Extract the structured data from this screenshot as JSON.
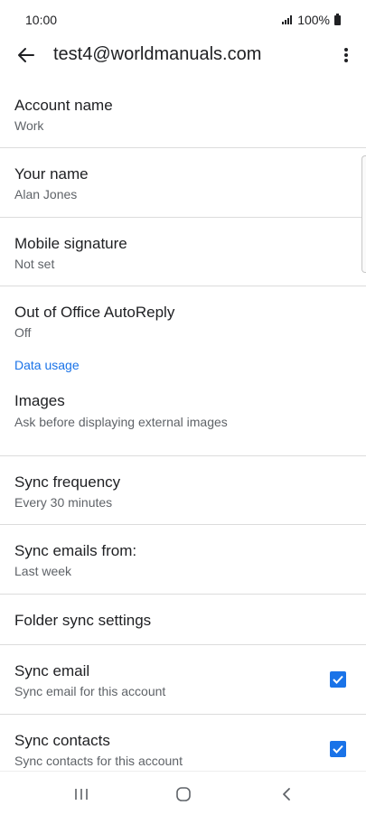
{
  "status": {
    "time": "10:00",
    "battery": "100%"
  },
  "header": {
    "title": "test4@worldmanuals.com"
  },
  "items": [
    {
      "label": "Account name",
      "sub": "Work"
    },
    {
      "label": "Your name",
      "sub": "Alan Jones"
    },
    {
      "label": "Mobile signature",
      "sub": "Not set"
    },
    {
      "label": "Out of Office AutoReply",
      "sub": "Off"
    }
  ],
  "data_usage": {
    "header": "Data usage",
    "items": [
      {
        "label": "Images",
        "sub": "Ask before displaying external images"
      },
      {
        "label": "Sync frequency",
        "sub": "Every 30 minutes"
      },
      {
        "label": "Sync emails from:",
        "sub": "Last week"
      },
      {
        "label": "Folder sync settings"
      },
      {
        "label": "Sync email",
        "sub": "Sync email for this account",
        "checked": true
      },
      {
        "label": "Sync contacts",
        "sub": "Sync contacts for this account",
        "checked": true
      }
    ]
  },
  "colors": {
    "accent": "#1a73e8",
    "text": "#202124",
    "subtext": "#5f6368",
    "divider": "#dcdcdc"
  },
  "icons": {
    "back": "back-arrow-icon",
    "more": "more-vert-icon",
    "signal": "signal-icon",
    "battery": "battery-icon",
    "recents": "recents-icon",
    "home": "home-icon",
    "nav_back": "nav-back-icon",
    "check": "check-icon"
  }
}
